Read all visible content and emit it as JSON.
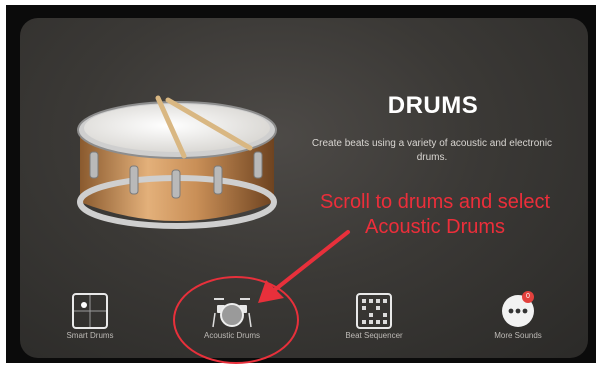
{
  "instrument": {
    "title": "DRUMS",
    "subtitle": "Create beats using a variety of acoustic and electronic drums."
  },
  "annotation": {
    "text": "Scroll to drums and select Acoustic Drums",
    "color": "#ec2e3a"
  },
  "tiles": [
    {
      "label": "Smart Drums",
      "icon": "smart-drums-grid-icon"
    },
    {
      "label": "Acoustic Drums",
      "icon": "drum-kit-icon"
    },
    {
      "label": "Beat Sequencer",
      "icon": "beat-sequencer-grid-icon"
    },
    {
      "label": "More Sounds",
      "icon": "more-ellipsis-icon",
      "badge": "0"
    }
  ],
  "colors": {
    "background": "#3b3936",
    "highlight": "#e8303b",
    "badge": "#e2413d"
  }
}
